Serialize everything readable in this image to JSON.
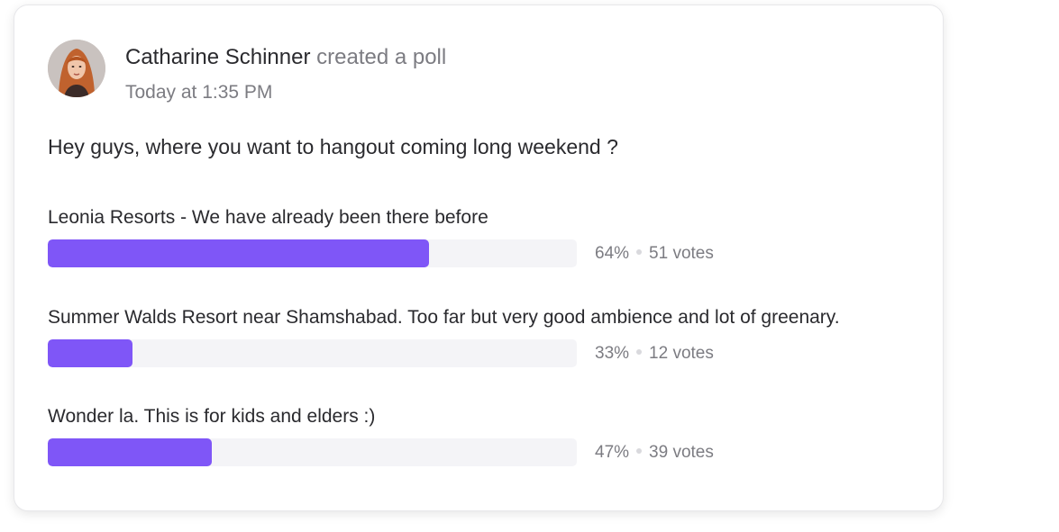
{
  "post": {
    "author": "Catharine Schinner",
    "action": "created a poll",
    "timestamp": "Today at 1:35 PM",
    "question": "Hey guys, where you want to hangout coming long weekend ?"
  },
  "options": [
    {
      "label": "Leonia Resorts - We have already been there before",
      "percent": "64%",
      "votes": "51 votes",
      "fill": 0.72
    },
    {
      "label": "Summer Walds Resort near Shamshabad. Too far but very good ambience and lot of greenary.",
      "percent": "33%",
      "votes": "12 votes",
      "fill": 0.16
    },
    {
      "label": "Wonder la. This is for kids and elders :)",
      "percent": "47%",
      "votes": "39 votes",
      "fill": 0.31
    }
  ],
  "colors": {
    "accent": "#7f56f7",
    "track": "#f4f4f7",
    "text_primary": "#2a2a2e",
    "text_secondary": "#7c7c82"
  }
}
